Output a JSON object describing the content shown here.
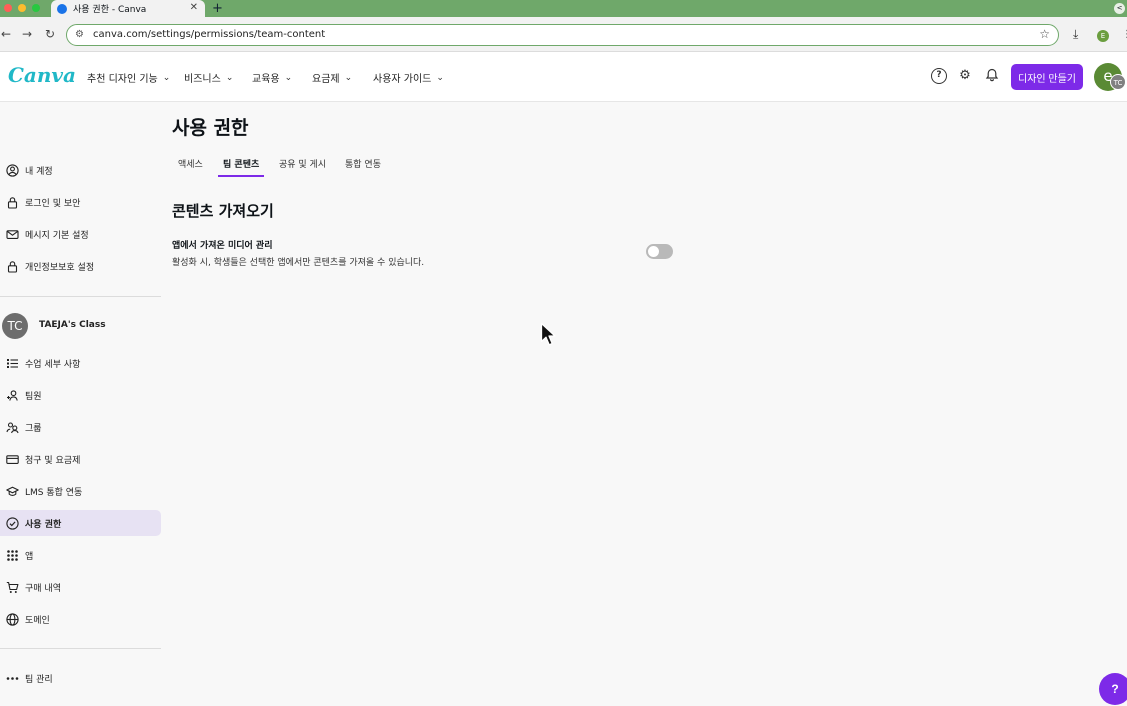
{
  "browser": {
    "tab_title": "사용 권한 - Canva",
    "tab_close": "✕",
    "new_tab": "+",
    "url": "canva.com/settings/permissions/team-content",
    "profile_initial": "E",
    "tabbar_right": "<"
  },
  "header": {
    "logo": "Canva",
    "menu": [
      {
        "label": "추천 디자인 기능"
      },
      {
        "label": "비즈니스"
      },
      {
        "label": "교육용"
      },
      {
        "label": "요금제"
      },
      {
        "label": "사용자 가이드"
      }
    ],
    "create_button": "디자인 만들기",
    "avatar_initial": "e",
    "avatar_badge": "TC"
  },
  "sidebar": {
    "account_items": [
      {
        "label": "내 계정",
        "icon": "user-circle-icon"
      },
      {
        "label": "로그인 및 보안",
        "icon": "lock-icon"
      },
      {
        "label": "메시지 기본 설정",
        "icon": "mail-icon"
      },
      {
        "label": "개인정보보호 설정",
        "icon": "lock-icon"
      }
    ],
    "team": {
      "avatar": "TC",
      "name": "TAEJA's Class"
    },
    "team_items": [
      {
        "label": "수업 세부 사항",
        "icon": "list-icon"
      },
      {
        "label": "팀원",
        "icon": "people-icon"
      },
      {
        "label": "그룹",
        "icon": "group-icon"
      },
      {
        "label": "청구 및 요금제",
        "icon": "card-icon"
      },
      {
        "label": "LMS 통합 연동",
        "icon": "graduation-cap-icon"
      },
      {
        "label": "사용 권한",
        "icon": "check-circle-icon",
        "active": true
      },
      {
        "label": "앱",
        "icon": "grid-icon"
      },
      {
        "label": "구매 내역",
        "icon": "cart-icon"
      },
      {
        "label": "도메인",
        "icon": "globe-icon"
      }
    ],
    "manage_team": {
      "label": "팀 관리",
      "icon": "more-icon"
    }
  },
  "main": {
    "title": "사용 권한",
    "tabs": [
      {
        "label": "액세스"
      },
      {
        "label": "팀 콘텐츠",
        "active": true
      },
      {
        "label": "공유 및 게시"
      },
      {
        "label": "통합 연동"
      }
    ],
    "section_title": "콘텐츠 가져오기",
    "setting": {
      "label": "앱에서 가져온 미디어 관리",
      "description": "활성화 시, 학생들은 선택한 앱에서만 콘텐츠를 가져올 수 있습니다.",
      "enabled": false
    }
  },
  "help_fab": "?",
  "colors": {
    "accent": "#7d2ae8",
    "logo": "#20b8c7",
    "browser_theme": "#6fa86a",
    "active_nav_bg": "#e7e2f3"
  }
}
